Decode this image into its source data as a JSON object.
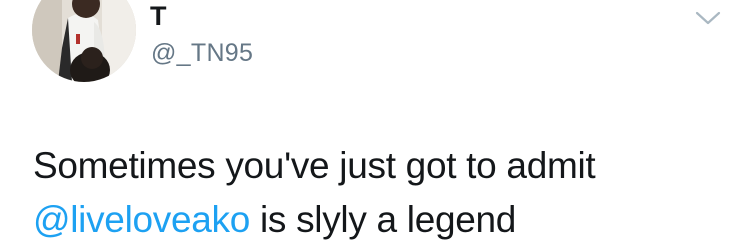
{
  "user": {
    "display_name": "T",
    "handle": "@_TN95",
    "avatar": "profile-photo"
  },
  "tweet": {
    "line1": "Sometimes you've just got to admit",
    "mention": "@liveloveako",
    "line2_rest": " is slyly a legend"
  },
  "icons": {
    "menu": "chevron-down-icon"
  },
  "colors": {
    "text": "#14171a",
    "handle": "#657786",
    "link": "#1da1f2",
    "chevron": "#aab8c2"
  }
}
